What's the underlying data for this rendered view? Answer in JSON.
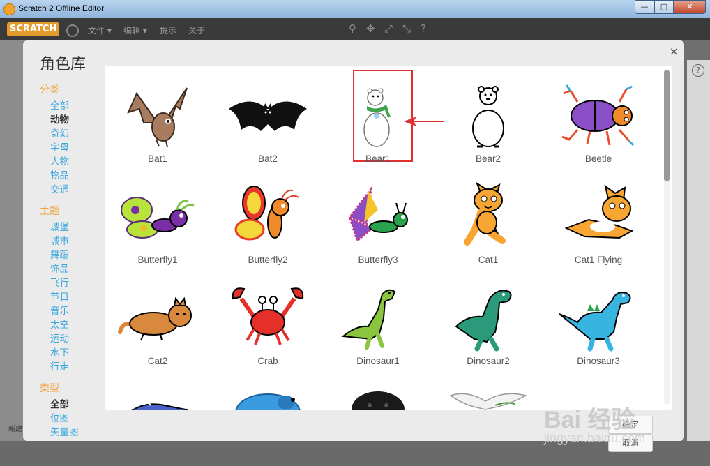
{
  "window": {
    "title": "Scratch 2 Offline Editor",
    "minimize": "—",
    "maximize": "□",
    "close": "✕"
  },
  "menubar": {
    "logo": "SCRATCH",
    "items": [
      "文件 ▾",
      "编辑 ▾",
      "提示",
      "关于"
    ]
  },
  "background": {
    "left_label": "新建"
  },
  "dialog": {
    "title": "角色库",
    "close": "×",
    "categories": [
      {
        "title": "分类",
        "items": [
          {
            "label": "全部",
            "active": false
          },
          {
            "label": "动物",
            "active": true
          },
          {
            "label": "奇幻",
            "active": false
          },
          {
            "label": "字母",
            "active": false
          },
          {
            "label": "人物",
            "active": false
          },
          {
            "label": "物品",
            "active": false
          },
          {
            "label": "交通",
            "active": false
          }
        ]
      },
      {
        "title": "主题",
        "items": [
          {
            "label": "城堡",
            "active": false
          },
          {
            "label": "城市",
            "active": false
          },
          {
            "label": "舞蹈",
            "active": false
          },
          {
            "label": "饰品",
            "active": false
          },
          {
            "label": "飞行",
            "active": false
          },
          {
            "label": "节日",
            "active": false
          },
          {
            "label": "音乐",
            "active": false
          },
          {
            "label": "太空",
            "active": false
          },
          {
            "label": "运动",
            "active": false
          },
          {
            "label": "水下",
            "active": false
          },
          {
            "label": "行走",
            "active": false
          }
        ]
      },
      {
        "title": "类型",
        "items": [
          {
            "label": "全部",
            "active": true
          },
          {
            "label": "位图",
            "active": false
          },
          {
            "label": "矢量图",
            "active": false
          }
        ]
      }
    ],
    "sprites": [
      {
        "name": "Bat1",
        "icon": "bat-brown-icon",
        "selected": false
      },
      {
        "name": "Bat2",
        "icon": "bat-black-icon",
        "selected": false
      },
      {
        "name": "Bear1",
        "icon": "polar-bear-icon",
        "selected": true
      },
      {
        "name": "Bear2",
        "icon": "bear-outline-icon",
        "selected": false
      },
      {
        "name": "Beetle",
        "icon": "beetle-icon",
        "selected": false
      },
      {
        "name": "Butterfly1",
        "icon": "butterfly-green-icon",
        "selected": false
      },
      {
        "name": "Butterfly2",
        "icon": "butterfly-orange-icon",
        "selected": false
      },
      {
        "name": "Butterfly3",
        "icon": "butterfly-purple-icon",
        "selected": false
      },
      {
        "name": "Cat1",
        "icon": "cat-icon",
        "selected": false
      },
      {
        "name": "Cat1 Flying",
        "icon": "cat-flying-icon",
        "selected": false
      },
      {
        "name": "Cat2",
        "icon": "cat-lying-icon",
        "selected": false
      },
      {
        "name": "Crab",
        "icon": "crab-icon",
        "selected": false
      },
      {
        "name": "Dinosaur1",
        "icon": "dinosaur-green-icon",
        "selected": false
      },
      {
        "name": "Dinosaur2",
        "icon": "dinosaur-teal-icon",
        "selected": false
      },
      {
        "name": "Dinosaur3",
        "icon": "dinosaur-blue-icon",
        "selected": false
      },
      {
        "name": "",
        "icon": "sneaker-icon",
        "selected": false
      },
      {
        "name": "",
        "icon": "dog-blue-icon",
        "selected": false
      },
      {
        "name": "",
        "icon": "dog-black-icon",
        "selected": false
      },
      {
        "name": "",
        "icon": "dove-icon",
        "selected": false
      }
    ],
    "ok_button": "确定",
    "cancel_button": "取消"
  },
  "watermark": {
    "brand": "Bai 经验",
    "url": "jingyan.baidu.com"
  },
  "colors": {
    "category_title": "#f2a23a",
    "category_link": "#3ca7df",
    "selection_border": "#e03131",
    "arrow": "#e03131"
  }
}
